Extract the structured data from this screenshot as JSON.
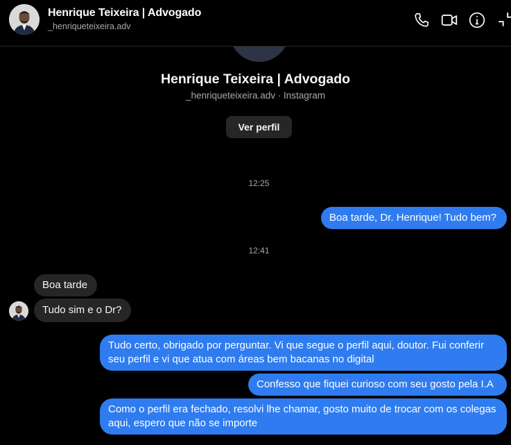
{
  "header": {
    "name": "Henrique Teixeira | Advogado",
    "username": "_henriqueteixeira.adv",
    "icons": [
      "phone-icon",
      "video-icon",
      "info-icon",
      "expand-icon"
    ]
  },
  "profile": {
    "name": "Henrique Teixeira | Advogado",
    "subtitle": "_henriqueteixeira.adv · Instagram",
    "view_profile_label": "Ver perfil"
  },
  "timestamps": [
    "12:25",
    "12:41"
  ],
  "messages": [
    {
      "from": "me",
      "text": "Boa tarde, Dr. Henrique! Tudo bem?"
    },
    {
      "from": "them",
      "text": "Boa tarde"
    },
    {
      "from": "them",
      "text": "Tudo sim e o Dr?"
    },
    {
      "from": "me",
      "text": "Tudo certo, obrigado por perguntar. Vi que segue o perfil aqui, doutor. Fui conferir seu perfil e vi que atua com áreas bem bacanas no digital"
    },
    {
      "from": "me",
      "text": "Confesso que fiquei curioso com seu gosto pela I.A"
    },
    {
      "from": "me",
      "text": "Como o perfil era fechado, resolvi lhe chamar, gosto muito de trocar com os colegas aqui, espero que não se importe"
    }
  ],
  "colors": {
    "background": "#000000",
    "outgoing_bubble": "#2f7cf0",
    "incoming_bubble": "#262626",
    "secondary_text": "#a8a8a8"
  }
}
